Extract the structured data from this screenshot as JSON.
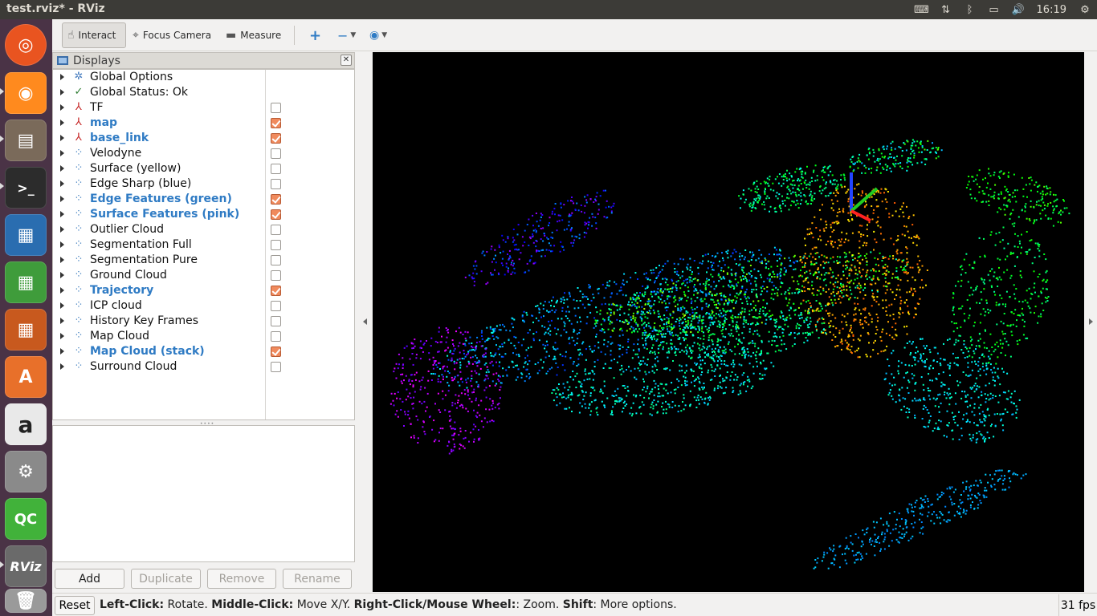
{
  "window": {
    "title": "test.rviz* - RViz"
  },
  "top_panel": {
    "clock": "16:19"
  },
  "toolbar": {
    "interact": "Interact",
    "focus_camera": "Focus Camera",
    "measure": "Measure"
  },
  "displays": {
    "title": "Displays",
    "items": [
      {
        "label": "Global Options",
        "icon": "gear-icon",
        "enabled": null
      },
      {
        "label": "Global Status: Ok",
        "icon": "check-icon",
        "enabled": null
      },
      {
        "label": "TF",
        "icon": "axis-icon",
        "enabled": false
      },
      {
        "label": "map",
        "icon": "axis-icon",
        "enabled": true
      },
      {
        "label": "base_link",
        "icon": "axis-icon",
        "enabled": true
      },
      {
        "label": "Velodyne",
        "icon": "pointcloud-icon",
        "enabled": false
      },
      {
        "label": "Surface (yellow)",
        "icon": "pointcloud-icon",
        "enabled": false
      },
      {
        "label": "Edge Sharp (blue)",
        "icon": "pointcloud-icon",
        "enabled": false
      },
      {
        "label": "Edge Features (green)",
        "icon": "pointcloud-icon",
        "enabled": true
      },
      {
        "label": "Surface Features (pink)",
        "icon": "pointcloud-icon",
        "enabled": true
      },
      {
        "label": "Outlier Cloud",
        "icon": "pointcloud-icon",
        "enabled": false
      },
      {
        "label": "Segmentation Full",
        "icon": "pointcloud-icon",
        "enabled": false
      },
      {
        "label": "Segmentation Pure",
        "icon": "pointcloud-icon",
        "enabled": false
      },
      {
        "label": "Ground Cloud",
        "icon": "pointcloud-icon",
        "enabled": false
      },
      {
        "label": "Trajectory",
        "icon": "pointcloud-icon",
        "enabled": true
      },
      {
        "label": "ICP cloud",
        "icon": "pointcloud-icon",
        "enabled": false
      },
      {
        "label": "History Key Frames",
        "icon": "pointcloud-icon",
        "enabled": false
      },
      {
        "label": "Map Cloud",
        "icon": "pointcloud-icon",
        "enabled": false
      },
      {
        "label": "Map Cloud (stack)",
        "icon": "pointcloud-icon",
        "enabled": true
      },
      {
        "label": "Surround Cloud",
        "icon": "pointcloud-icon",
        "enabled": false
      }
    ],
    "buttons": {
      "add": "Add",
      "duplicate": "Duplicate",
      "remove": "Remove",
      "rename": "Rename"
    }
  },
  "statusbar": {
    "reset": "Reset",
    "hint_left_click_key": "Left-Click:",
    "hint_left_click_val": " Rotate. ",
    "hint_middle_click_key": "Middle-Click:",
    "hint_middle_click_val": " Move X/Y. ",
    "hint_right_click_key": "Right-Click/Mouse Wheel:",
    "hint_right_click_val": ": Zoom. ",
    "hint_shift_key": "Shift",
    "hint_shift_val": ": More options.",
    "fps": "31 fps"
  },
  "launcher": {
    "items": [
      "ubuntu-logo-icon",
      "firefox-icon",
      "files-icon",
      "terminal-icon",
      "writer-icon",
      "calc-icon",
      "impress-icon",
      "software-center-icon",
      "amazon-icon",
      "system-settings-icon",
      "qtcreator-icon",
      "rviz-icon",
      "trash-icon"
    ],
    "qc_label": "QC",
    "rviz_label": "RViz",
    "amazon_label": "a",
    "software_label": "A"
  },
  "colors": {
    "launcher_bg": "#4a3346",
    "panel_bg": "#3c3b37",
    "checked": "#f08a5d",
    "enabled_label": "#2f7bc4",
    "view_bg": "#000000"
  }
}
